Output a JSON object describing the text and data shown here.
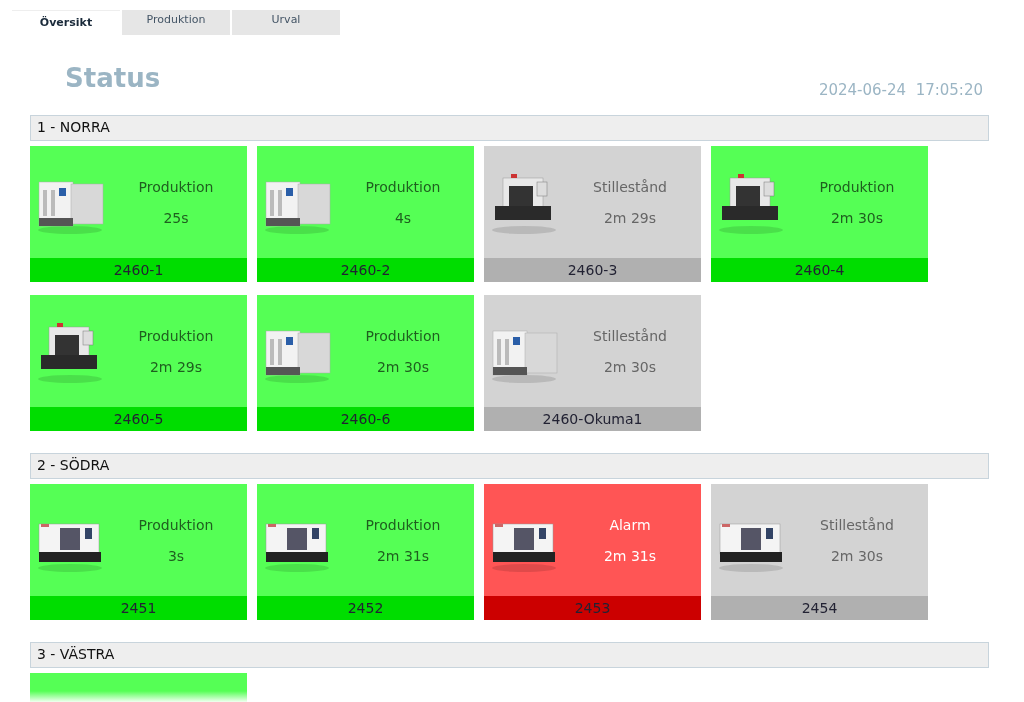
{
  "tabs": [
    {
      "label": "Översikt",
      "selected": true
    },
    {
      "label": "Produktion",
      "selected": false
    },
    {
      "label": "Urval",
      "selected": false
    }
  ],
  "title": "Status",
  "date": "2024-06-24",
  "time": "17:05:20",
  "groups": [
    {
      "name": "1 - NORRA",
      "machines": [
        {
          "kind": "production",
          "state": "Produktion",
          "duration": "25s",
          "id": "2460-1"
        },
        {
          "kind": "production",
          "state": "Produktion",
          "duration": "4s",
          "id": "2460-2"
        },
        {
          "kind": "idle",
          "state": "Stillestånd",
          "duration": "2m 29s",
          "id": "2460-3"
        },
        {
          "kind": "production",
          "state": "Produktion",
          "duration": "2m 30s",
          "id": "2460-4"
        },
        {
          "kind": "production",
          "state": "Produktion",
          "duration": "2m 29s",
          "id": "2460-5"
        },
        {
          "kind": "production",
          "state": "Produktion",
          "duration": "2m 30s",
          "id": "2460-6"
        },
        {
          "kind": "idle",
          "state": "Stillestånd",
          "duration": "2m 30s",
          "id": "2460-Okuma1"
        }
      ]
    },
    {
      "name": "2 - SÖDRA",
      "machines": [
        {
          "kind": "production",
          "state": "Produktion",
          "duration": "3s",
          "id": "2451"
        },
        {
          "kind": "production",
          "state": "Produktion",
          "duration": "2m 31s",
          "id": "2452"
        },
        {
          "kind": "alarm",
          "state": "Alarm",
          "duration": "2m 31s",
          "id": "2453"
        },
        {
          "kind": "idle",
          "state": "Stillestånd",
          "duration": "2m 30s",
          "id": "2454"
        }
      ]
    },
    {
      "name": "3 - VÄSTRA",
      "machines": [
        {
          "kind": "production"
        }
      ]
    }
  ]
}
